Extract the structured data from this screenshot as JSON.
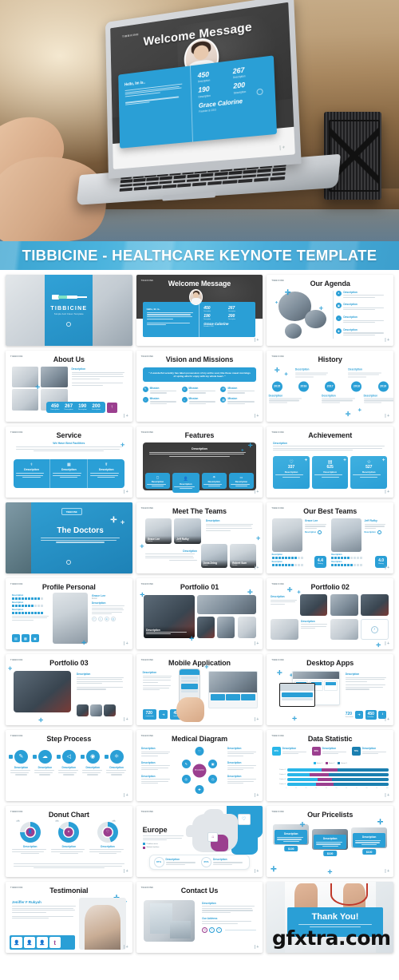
{
  "banner": {
    "title": "TIBBICINE - HEALTHCARE KEYNOTE TEMPLATE",
    "color": "#3fa9d4"
  },
  "hero": {
    "logo": "TIBBICINE",
    "slide_title": "Welcome Message",
    "greeting": "Hello, Im is..",
    "stats": [
      {
        "number": "450",
        "label": "Description"
      },
      {
        "number": "267",
        "label": "Description"
      },
      {
        "number": "190",
        "label": "Description"
      },
      {
        "number": "200",
        "label": "Description"
      }
    ],
    "person_name": "Grace Calorine",
    "person_role": "Founder & CEO",
    "pager": "| +"
  },
  "theme": {
    "primary": "#2a9fd6",
    "primary_dark": "#1b7fb0",
    "magenta": "#9b3f8f",
    "dark": "#3d3d3d",
    "text": "#1d1d1f"
  },
  "common": {
    "logo": "TIBBICINE",
    "pager": "| +",
    "description": "Description",
    "mission": "Mission"
  },
  "slides": [
    {
      "id": 1,
      "title": "TIBBICINE",
      "subtitle": "Simple And Clean Template",
      "kind": "cover"
    },
    {
      "id": 2,
      "title": "Welcome Message",
      "kind": "welcome"
    },
    {
      "id": 3,
      "title": "Our Agenda",
      "kind": "agenda"
    },
    {
      "id": 4,
      "title": "About Us",
      "kind": "about"
    },
    {
      "id": 5,
      "title": "Vision and Missions",
      "kind": "vision"
    },
    {
      "id": 6,
      "title": "History",
      "kind": "history"
    },
    {
      "id": 7,
      "title": "Service",
      "kind": "service"
    },
    {
      "id": 8,
      "title": "Features",
      "kind": "features"
    },
    {
      "id": 9,
      "title": "Achievement",
      "kind": "achievement"
    },
    {
      "id": 10,
      "title": "The Doctors",
      "kind": "doctors-cover"
    },
    {
      "id": 11,
      "title": "Meet The Teams",
      "kind": "meet-teams"
    },
    {
      "id": 12,
      "title": "Our Best Teams",
      "kind": "best-teams"
    },
    {
      "id": 13,
      "title": "Profile Personal",
      "kind": "profile"
    },
    {
      "id": 14,
      "title": "Portfolio 01",
      "kind": "portfolio1"
    },
    {
      "id": 15,
      "title": "Portfolio 02",
      "kind": "portfolio2"
    },
    {
      "id": 16,
      "title": "Portfolio 03",
      "kind": "portfolio3"
    },
    {
      "id": 17,
      "title": "Mobile Application",
      "kind": "mobile"
    },
    {
      "id": 18,
      "title": "Desktop Apps",
      "kind": "desktop"
    },
    {
      "id": 19,
      "title": "Step Process",
      "kind": "steps"
    },
    {
      "id": 20,
      "title": "Medical Diagram",
      "kind": "diagram"
    },
    {
      "id": 21,
      "title": "Data Statistic",
      "kind": "statistic"
    },
    {
      "id": 22,
      "title": "Donut Chart",
      "kind": "donut"
    },
    {
      "id": 23,
      "title": "Europe",
      "kind": "europe"
    },
    {
      "id": 24,
      "title": "Our Pricelists",
      "kind": "pricelists"
    },
    {
      "id": 25,
      "title": "Testimonial",
      "kind": "testimonial"
    },
    {
      "id": 26,
      "title": "Contact Us",
      "kind": "contact"
    },
    {
      "id": 27,
      "title": "Thank You!",
      "kind": "thankyou"
    }
  ],
  "about": {
    "stats": [
      {
        "number": "450",
        "label": "Description"
      },
      {
        "number": "267",
        "label": "Description"
      },
      {
        "number": "190",
        "label": "Description"
      },
      {
        "number": "200",
        "label": "Description"
      }
    ]
  },
  "vision": {
    "quote": "\" A wonderful serenity has taken possession of my entire soul, like these sweet mornings of spring which I enjoy with my whole heart. \"",
    "missions": [
      "Mission",
      "Mission",
      "Mission",
      "Mission",
      "Mission",
      "Mission"
    ]
  },
  "history": {
    "years": [
      "2015",
      "2016",
      "2017",
      "2018",
      "2019"
    ]
  },
  "service": {
    "subtitle": "We Have Best Facilities"
  },
  "achievement": {
    "values": [
      "337",
      "625",
      "527"
    ]
  },
  "best_teams": {
    "members": [
      {
        "name": "Grace Lee",
        "role": "Doctor",
        "rating": "4.4",
        "rating_label": "Rating"
      },
      {
        "name": "Jeff Rufky",
        "role": "Doctor",
        "rating": "4.0",
        "rating_label": "Rating"
      }
    ]
  },
  "meet_teams": {
    "members": [
      {
        "name": "Grace Lee",
        "role": "Doctor"
      },
      {
        "name": "Jeff Rufky",
        "role": "Doctor"
      },
      {
        "name": "Dona Zeing",
        "role": "Nurse"
      },
      {
        "name": "Robert Sum",
        "role": "Doctor"
      }
    ]
  },
  "profile": {
    "name": "Grace Lee",
    "role": "Doctor"
  },
  "mobile": {
    "stats": [
      {
        "number": "720",
        "label": "Downloads"
      },
      {
        "number": "450",
        "label": "Installed"
      }
    ]
  },
  "desktop": {
    "stats": [
      {
        "number": "720",
        "label": "Downloads"
      },
      {
        "number": "450",
        "label": "Installed"
      }
    ]
  },
  "europe": {
    "legend": [
      "Problem areas",
      "Medical facilities"
    ],
    "stats": [
      {
        "value": "87%",
        "label": "Description"
      },
      {
        "value": "65%",
        "label": "Description"
      }
    ]
  },
  "pricelists": {
    "prices": [
      "$100",
      "$100",
      "$100"
    ]
  },
  "testimonial": {
    "name": "Jeniffer F Rukyah"
  },
  "contact": {
    "address_label": "Our Address"
  },
  "thankyou": {
    "text": "Thank You!"
  },
  "watermark": "gfxtra.com",
  "chart_data": {
    "type": "bar",
    "title": "Data Statistic",
    "orientation": "horizontal",
    "stacked": true,
    "categories": [
      "Product 1",
      "Product 2",
      "Product 3",
      "Product 4"
    ],
    "series": [
      {
        "name": "Series 1",
        "color": "#29b6e8",
        "values": [
          34,
          22,
          30,
          28
        ]
      },
      {
        "name": "Series 2",
        "color": "#9b3f8f",
        "values": [
          16,
          19,
          14,
          18
        ]
      },
      {
        "name": "Series 3",
        "color": "#1b7fb0",
        "values": [
          50,
          59,
          56,
          54
        ]
      }
    ],
    "legend_position": "top",
    "xlabel": "",
    "ylabel": "",
    "xlim": [
      0,
      100
    ],
    "grid": false,
    "cards": [
      {
        "value": "80%",
        "label": "Description",
        "color": "#29b6e8"
      },
      {
        "value": "60%",
        "label": "Description",
        "color": "#9b3f8f"
      },
      {
        "value": "70%",
        "label": "Description",
        "color": "#1b7fb0"
      }
    ]
  },
  "donut_chart_data": {
    "type": "pie",
    "title": "Donut Chart",
    "charts": [
      {
        "label": "Description",
        "value": 75,
        "rest": 25,
        "color": "#2a9fd6"
      },
      {
        "label": "Description",
        "value": 82,
        "rest": 18,
        "color": "#2a9fd6"
      },
      {
        "label": "Description",
        "value": 45,
        "rest": 55,
        "color": "#2a9fd6"
      }
    ]
  }
}
